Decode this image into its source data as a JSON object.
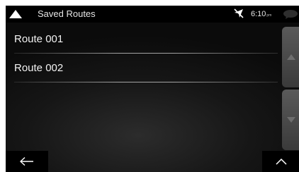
{
  "header": {
    "title": "Saved Routes",
    "home_icon": "triangle-up-icon",
    "gps_icon": "gps-off-icon",
    "time": "6:10",
    "time_suffix": "pm",
    "message_icon": "message-bubble-icon"
  },
  "routes": [
    {
      "label": "Route 001"
    },
    {
      "label": "Route 002"
    }
  ],
  "scroll": {
    "up_icon": "scroll-up-icon",
    "down_icon": "scroll-down-icon"
  },
  "footer": {
    "back_icon": "back-arrow-icon",
    "menu_icon": "chevron-up-icon"
  },
  "colors": {
    "background": "#151515",
    "bar": "#000000",
    "text": "#f2f2f2",
    "scroll_button": "#4a4a4a"
  }
}
